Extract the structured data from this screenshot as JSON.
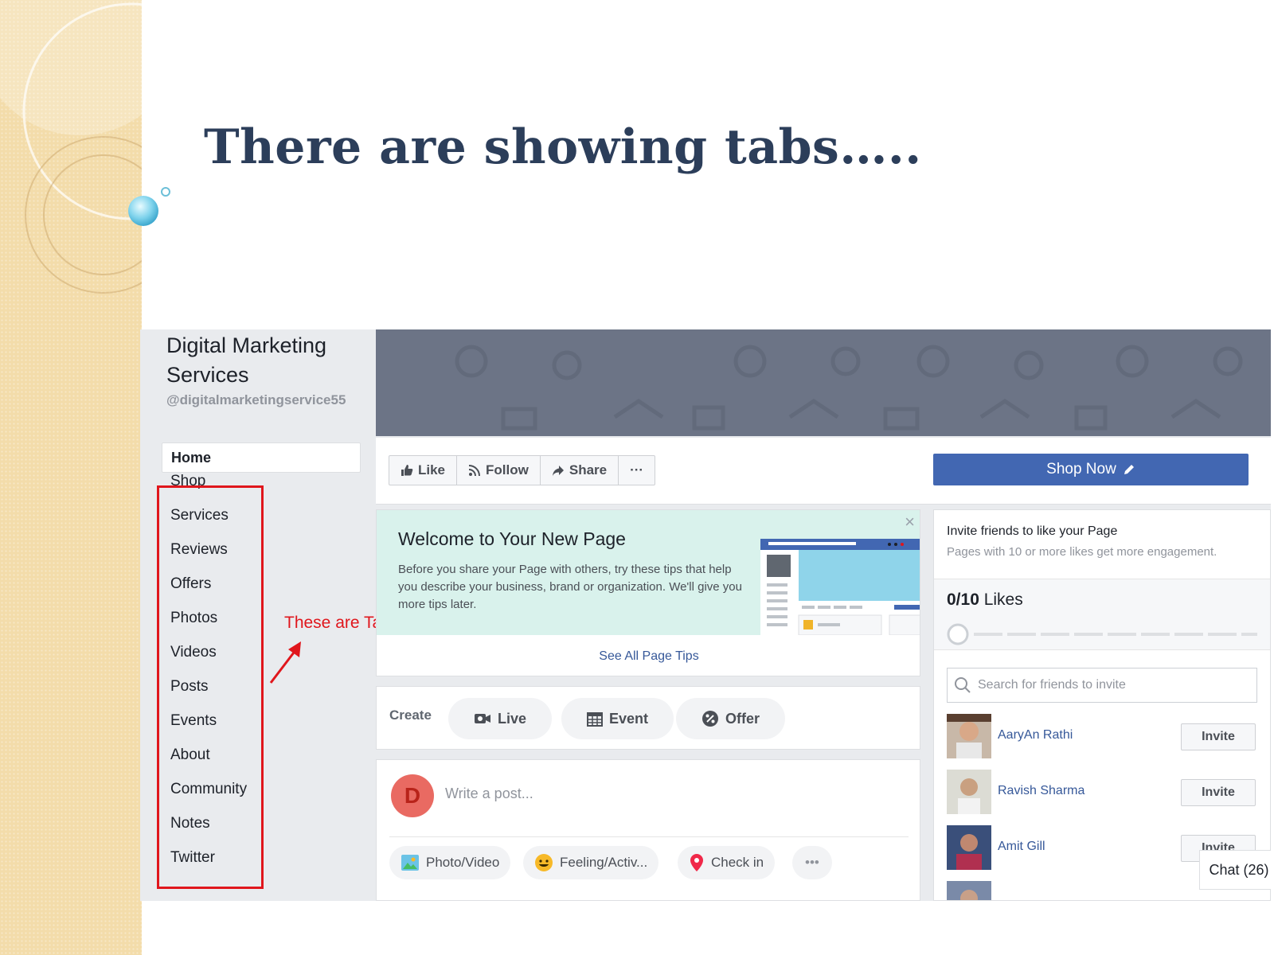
{
  "slide": {
    "title": "There are showing tabs….."
  },
  "page": {
    "name": "Digital Marketing Services",
    "handle": "@digitalmarketingservice55"
  },
  "nav": {
    "home": "Home",
    "tabs": [
      "Shop",
      "Services",
      "Reviews",
      "Offers",
      "Photos",
      "Videos",
      "Posts",
      "Events",
      "About",
      "Community",
      "Notes",
      "Twitter"
    ]
  },
  "annotation": {
    "text": "These are Tabs",
    "color": "#e0161c"
  },
  "actions": {
    "like": "Like",
    "follow": "Follow",
    "share": "Share",
    "more": "···",
    "shop_now": "Shop Now"
  },
  "welcome": {
    "title": "Welcome to Your New Page",
    "body": "Before you share your Page with others, try these tips that help you describe your business, brand or organization. We'll give you more tips later.",
    "close": "×",
    "see_all": "See All Page Tips"
  },
  "create": {
    "label": "Create",
    "live": "Live",
    "event": "Event",
    "offer": "Offer"
  },
  "composer": {
    "avatar_letter": "D",
    "placeholder": "Write a post...",
    "photo_video": "Photo/Video",
    "feeling": "Feeling/Activ...",
    "check_in": "Check in",
    "more": "•••"
  },
  "invite": {
    "title": "Invite friends to like your Page",
    "subtitle": "Pages with 10 or more likes get more engagement.",
    "likes_value": "0/10",
    "likes_label": " Likes",
    "likes_progress": 0,
    "search_placeholder": "Search for friends to invite",
    "friends": [
      {
        "name": "AaryAn Rathi",
        "button": "Invite"
      },
      {
        "name": "Ravish Sharma",
        "button": "Invite"
      },
      {
        "name": "Amit Gill",
        "button": "Invite"
      }
    ]
  },
  "chat": {
    "label": "Chat (26)"
  },
  "colors": {
    "brand_blue": "#4267b2",
    "link": "#365899",
    "cover": "#6c7486",
    "highlight_red": "#e0161c"
  }
}
